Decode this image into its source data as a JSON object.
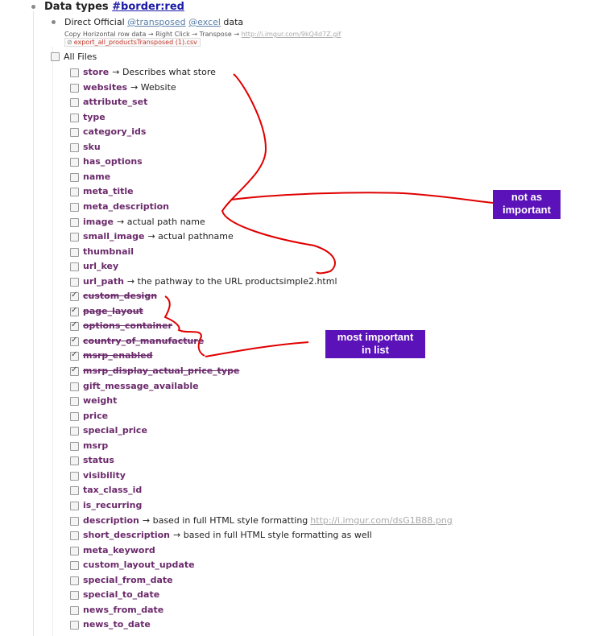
{
  "header": {
    "title_prefix": "Data types",
    "title_tag": "#border:red",
    "direct_prefix": "Direct Official",
    "tag1": "@transposed",
    "tag2": "@excel",
    "direct_suffix": "data",
    "copy_text": "Copy Horizontal row data → Right Click → Transpose →",
    "copy_link": "http://i.imgur.com/9kQ4d7Z.gif",
    "attachment": "export_all_productsTransposed (1).csv",
    "all_files": "All Files"
  },
  "items": [
    {
      "key": "store",
      "desc": "→ Describes what store",
      "checked": false
    },
    {
      "key": "websites",
      "desc": "→ Website",
      "checked": false
    },
    {
      "key": "attribute_set",
      "desc": "",
      "checked": false
    },
    {
      "key": "type",
      "desc": "",
      "checked": false
    },
    {
      "key": "category_ids",
      "desc": "",
      "checked": false
    },
    {
      "key": "sku",
      "desc": "",
      "checked": false
    },
    {
      "key": "has_options",
      "desc": "",
      "checked": false
    },
    {
      "key": "name",
      "desc": "",
      "checked": false
    },
    {
      "key": "meta_title",
      "desc": "",
      "checked": false
    },
    {
      "key": "meta_description",
      "desc": "",
      "checked": false
    },
    {
      "key": "image",
      "desc": "→ actual path name",
      "checked": false
    },
    {
      "key": "small_image",
      "desc": "→ actual pathname",
      "checked": false
    },
    {
      "key": "thumbnail",
      "desc": "",
      "checked": false
    },
    {
      "key": "url_key",
      "desc": "",
      "checked": false
    },
    {
      "key": "url_path",
      "desc": "→ the pathway to the URL productsimple2.html",
      "checked": false
    },
    {
      "key": "custom_design",
      "desc": "",
      "checked": true
    },
    {
      "key": "page_layout",
      "desc": "",
      "checked": true
    },
    {
      "key": "options_container",
      "desc": "",
      "checked": true
    },
    {
      "key": "country_of_manufacture",
      "desc": "",
      "checked": true
    },
    {
      "key": "msrp_enabled",
      "desc": "",
      "checked": true
    },
    {
      "key": "msrp_display_actual_price_type",
      "desc": "",
      "checked": true
    },
    {
      "key": "gift_message_available",
      "desc": "",
      "checked": false
    },
    {
      "key": "weight",
      "desc": "",
      "checked": false
    },
    {
      "key": "price",
      "desc": "",
      "checked": false
    },
    {
      "key": "special_price",
      "desc": "",
      "checked": false
    },
    {
      "key": "msrp",
      "desc": "",
      "checked": false
    },
    {
      "key": "status",
      "desc": "",
      "checked": false
    },
    {
      "key": "visibility",
      "desc": "",
      "checked": false
    },
    {
      "key": "tax_class_id",
      "desc": "",
      "checked": false
    },
    {
      "key": "is_recurring",
      "desc": "",
      "checked": false
    },
    {
      "key": "description",
      "desc": "→ based in full HTML style formatting",
      "link": "http://i.imgur.com/dsG1B88.png",
      "checked": false
    },
    {
      "key": "short_description",
      "desc": "→ based in full HTML style formatting as well",
      "checked": false
    },
    {
      "key": "meta_keyword",
      "desc": "",
      "checked": false
    },
    {
      "key": "custom_layout_update",
      "desc": "",
      "checked": false
    },
    {
      "key": "special_from_date",
      "desc": "",
      "checked": false
    },
    {
      "key": "special_to_date",
      "desc": "",
      "checked": false
    },
    {
      "key": "news_from_date",
      "desc": "",
      "checked": false
    },
    {
      "key": "news_to_date",
      "desc": "",
      "checked": false
    }
  ],
  "annotations": {
    "not_important_1": "not as",
    "not_important_2": "important",
    "most_important_1": "most important",
    "most_important_2": "in list",
    "box_color": "#5b12b8",
    "ink_color": "#e00000"
  }
}
